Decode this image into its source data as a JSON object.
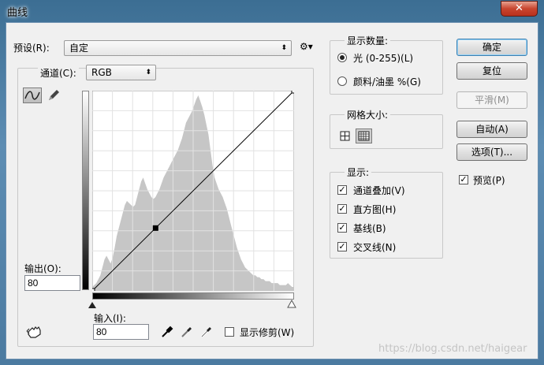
{
  "window": {
    "title": "曲线",
    "close_glyph": "✕"
  },
  "preset": {
    "label": "预设(R):",
    "value": "自定",
    "gear": "⚙▾"
  },
  "channel": {
    "label": "通道(C):",
    "value": "RGB"
  },
  "output": {
    "label": "输出(O):",
    "value": "80"
  },
  "input": {
    "label": "输入(I):",
    "value": "80"
  },
  "show_clipping": {
    "label": "显示修剪(W)",
    "checked": false
  },
  "display_amount": {
    "title": "显示数量:",
    "options": [
      {
        "label": "光 (0-255)(L)",
        "selected": true
      },
      {
        "label": "颜料/油墨 %(G)",
        "selected": false
      }
    ]
  },
  "grid_size": {
    "title": "网格大小:"
  },
  "show": {
    "title": "显示:",
    "options": [
      {
        "label": "通道叠加(V)",
        "checked": true
      },
      {
        "label": "直方图(H)",
        "checked": true
      },
      {
        "label": "基线(B)",
        "checked": true
      },
      {
        "label": "交叉线(N)",
        "checked": true
      }
    ]
  },
  "buttons": {
    "ok": "确定",
    "reset": "复位",
    "smooth": "平滑(M)",
    "auto": "自动(A)",
    "options": "选项(T)..."
  },
  "preview": {
    "label": "预览(P)",
    "checked": true
  },
  "curve": {
    "points": [
      [
        0,
        0
      ],
      [
        80,
        80
      ],
      [
        255,
        255
      ]
    ]
  },
  "histogram": [
    2,
    3,
    4,
    6,
    8,
    12,
    16,
    18,
    16,
    14,
    17,
    22,
    28,
    32,
    36,
    40,
    44,
    46,
    45,
    44,
    43,
    44,
    48,
    52,
    56,
    58,
    55,
    52,
    50,
    48,
    47,
    48,
    50,
    52,
    55,
    58,
    60,
    62,
    64,
    66,
    68,
    70,
    72,
    75,
    78,
    82,
    86,
    88,
    90,
    92,
    95,
    98,
    100,
    97,
    94,
    90,
    85,
    80,
    72,
    64,
    58,
    55,
    52,
    50,
    48,
    45,
    42,
    38,
    34,
    30,
    26,
    22,
    19,
    16,
    14,
    12,
    11,
    10,
    9,
    8,
    8,
    7,
    7,
    6,
    6,
    5,
    5,
    5,
    4,
    4,
    4,
    4,
    3,
    3,
    3,
    3,
    4,
    3,
    2,
    2
  ],
  "watermark": "https://blog.csdn.net/haigear",
  "colors": {
    "histogram_fill": "#c6c6c6",
    "grid": "#e2e2e2",
    "curve": "#000000"
  }
}
